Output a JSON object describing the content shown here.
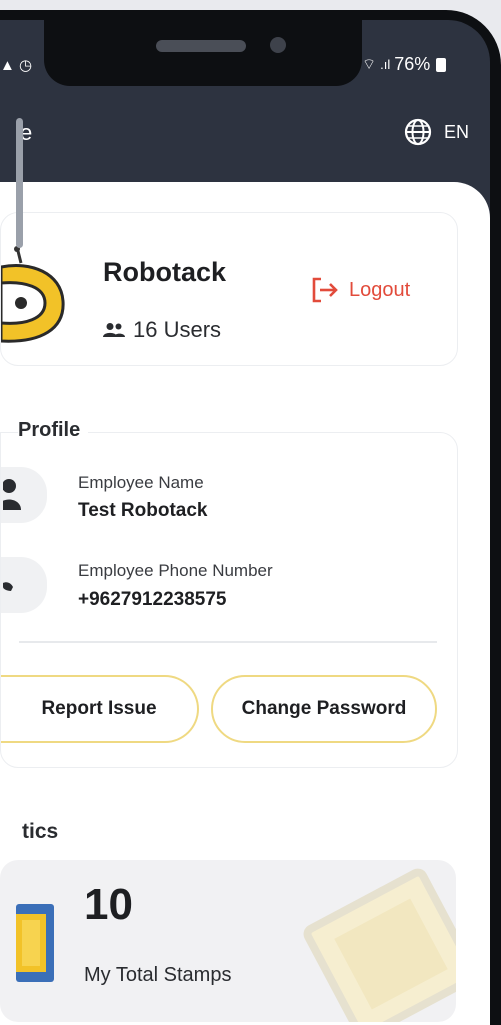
{
  "status_bar": {
    "battery": "76%"
  },
  "header": {
    "title": "e",
    "language": "EN"
  },
  "company": {
    "name": "Robotack",
    "users": "16 Users",
    "logout_label": "Logout"
  },
  "profile": {
    "section_title": "Profile",
    "employee_name_label": "Employee Name",
    "employee_name": "Test Robotack",
    "phone_label": "Employee Phone Number",
    "phone": "+9627912238575",
    "report_issue": "Report Issue",
    "change_password": "Change Password"
  },
  "statistics": {
    "section_title": "tics",
    "stamps_value": "10",
    "stamps_label": "My Total Stamps"
  },
  "colors": {
    "accent": "#e24b3b",
    "brand_yellow": "#f2c228",
    "header_bg": "#2d3340"
  }
}
